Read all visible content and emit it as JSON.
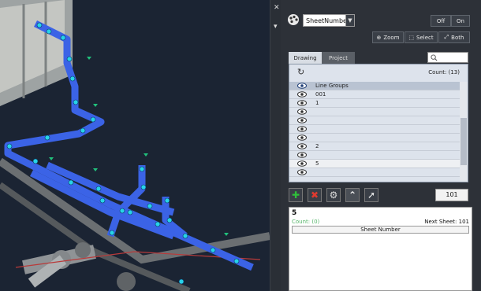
{
  "toolbar": {
    "combo_value": "SheetNumber",
    "off_label": "Off",
    "on_label": "On",
    "zoom_label": "Zoom",
    "select_label": "Select",
    "both_label": "Both"
  },
  "tabs": [
    {
      "label": "Drawing",
      "active": true
    },
    {
      "label": "Project",
      "active": false
    }
  ],
  "list": {
    "count_text": "Count: (13)",
    "header_label": "Line Groups",
    "rows": [
      "001",
      "1",
      "",
      "",
      "",
      "",
      "2",
      "",
      "5",
      ""
    ]
  },
  "controls": {
    "number_value": "101"
  },
  "detail": {
    "title": "5",
    "count_text": "Count: (0)",
    "next_sheet": "Next Sheet: 101",
    "column_header": "Sheet Number"
  },
  "colors": {
    "pipe_highlight": "#3b63e6",
    "marker": "#27d3e8",
    "add": "#2fbf3a",
    "remove": "#e03a2f"
  },
  "icons": [
    "palette-icon",
    "chevron-down-icon",
    "zoom-icon",
    "select-icon",
    "both-icon",
    "search-icon",
    "refresh-icon",
    "eye-icon",
    "add-icon",
    "remove-icon",
    "gear-icon",
    "up-arrow-icon",
    "cursor-add-icon"
  ]
}
